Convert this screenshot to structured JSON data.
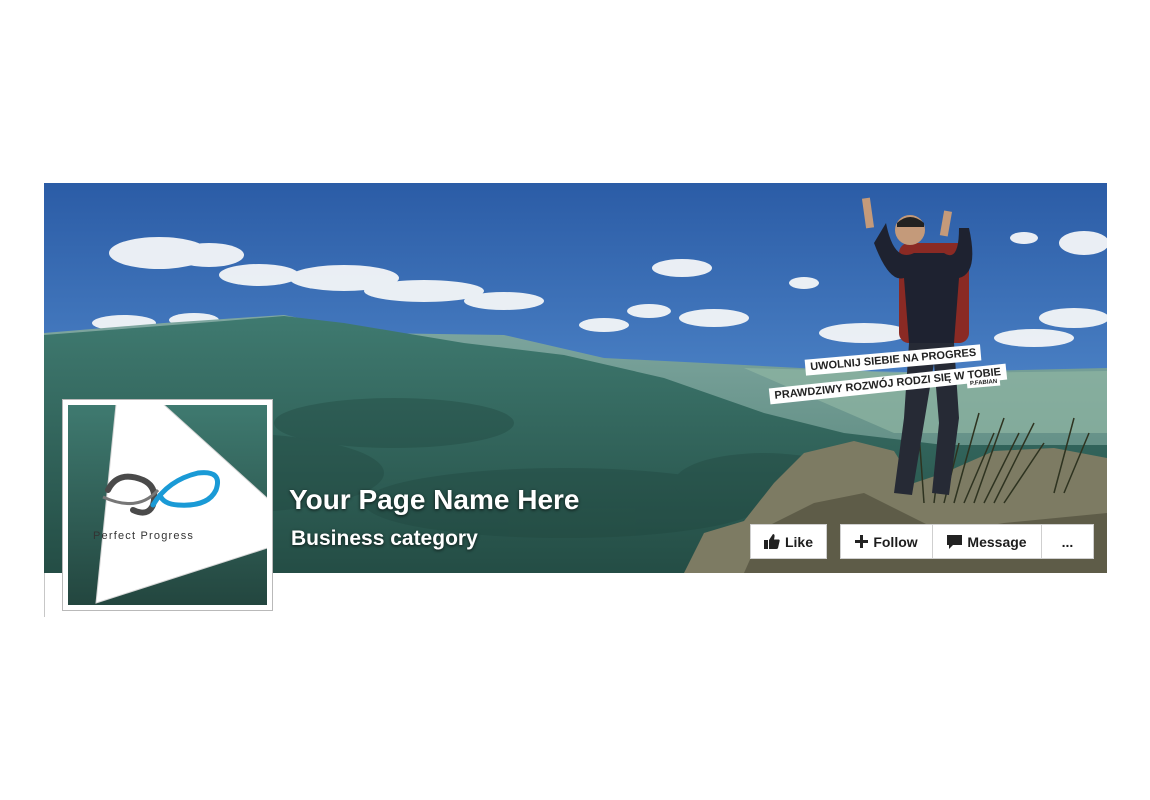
{
  "page": {
    "name": "Your Page Name Here",
    "category": "Business category"
  },
  "profile": {
    "logo_text": "Perfect Progress"
  },
  "cover": {
    "quote_line_1": "UWOLNIJ SIEBIE NA PROGRES",
    "quote_line_2": "PRAWDZIWY ROZWÓJ RODZI SIĘ W TOBIE",
    "quote_author": "P.FABIAN"
  },
  "actions": {
    "like_label": "Like",
    "follow_label": "Follow",
    "message_label": "Message",
    "more_label": "..."
  },
  "icons": {
    "like": "thumbs-up-icon",
    "follow": "plus-icon",
    "message": "speech-bubble-icon"
  },
  "colors": {
    "sky_top": "#2e5fa8",
    "sky_bottom": "#6fa3d8",
    "mountain": "#35675e",
    "button_bg": "#ffffff",
    "logo_accent": "#1a9ad6"
  }
}
